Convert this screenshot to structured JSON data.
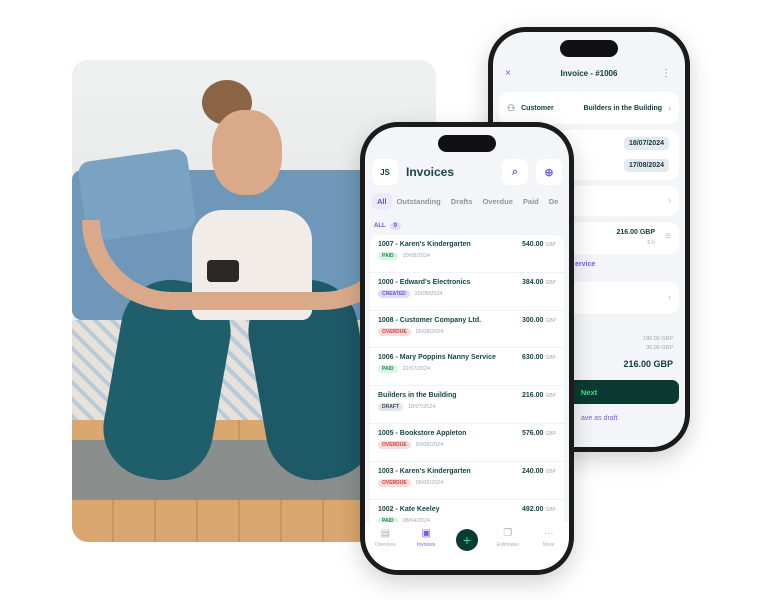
{
  "back_phone": {
    "title": "Invoice - #1006",
    "close_icon": "×",
    "more_icon": "⋮",
    "customer_label": "Customer",
    "customer_value": "Builders in the Building",
    "issue_date": "18/07/2024",
    "due_date": "17/08/2024",
    "line_amount": "216.00 GBP",
    "line_qty": "6 h",
    "service_link": "ervice",
    "subtotal": "180.00 GBP",
    "tax": "36.00 GBP",
    "total": "216.00 GBP",
    "next_label": "Next",
    "save_draft_label": "ave as draft"
  },
  "front_phone": {
    "avatar_initials": "JS",
    "title": "Invoices",
    "search_icon": "⌕",
    "add_icon": "⊕",
    "tabs": [
      "All",
      "Outstanding",
      "Drafts",
      "Overdue",
      "Paid",
      "De"
    ],
    "all_label": "ALL",
    "all_count": "9",
    "currency": "GBP",
    "invoices": [
      {
        "name": "1007 - Karen's Kindergarten",
        "amount": "540.00",
        "status": "PAID",
        "date": "20/08/2024"
      },
      {
        "name": "1000 - Edward's Electronics",
        "amount": "384.00",
        "status": "CREATED",
        "date": "20/08/2024"
      },
      {
        "name": "1008 - Customer Company Ltd.",
        "amount": "300.00",
        "status": "OVERDUE",
        "date": "05/08/2024"
      },
      {
        "name": "1006 - Mary Poppins Nanny Service",
        "amount": "630.00",
        "status": "PAID",
        "date": "22/07/2024"
      },
      {
        "name": "Builders in the Building",
        "amount": "216.00",
        "status": "DRAFT",
        "date": "18/07/2024"
      },
      {
        "name": "1005 - Bookstore Appleton",
        "amount": "576.00",
        "status": "OVERDUE",
        "date": "03/06/2024"
      },
      {
        "name": "1003 - Karen's Kindergarten",
        "amount": "240.00",
        "status": "OVERDUE",
        "date": "06/05/2024"
      },
      {
        "name": "1002 - Kate Keeley",
        "amount": "492.00",
        "status": "PAID",
        "date": "08/04/2024"
      }
    ],
    "nav": [
      {
        "label": "Overview",
        "icon": "▤"
      },
      {
        "label": "Invoices",
        "icon": "▣"
      },
      {
        "label": "",
        "icon": "+"
      },
      {
        "label": "Estimates",
        "icon": "❐"
      },
      {
        "label": "More",
        "icon": "···"
      }
    ]
  }
}
